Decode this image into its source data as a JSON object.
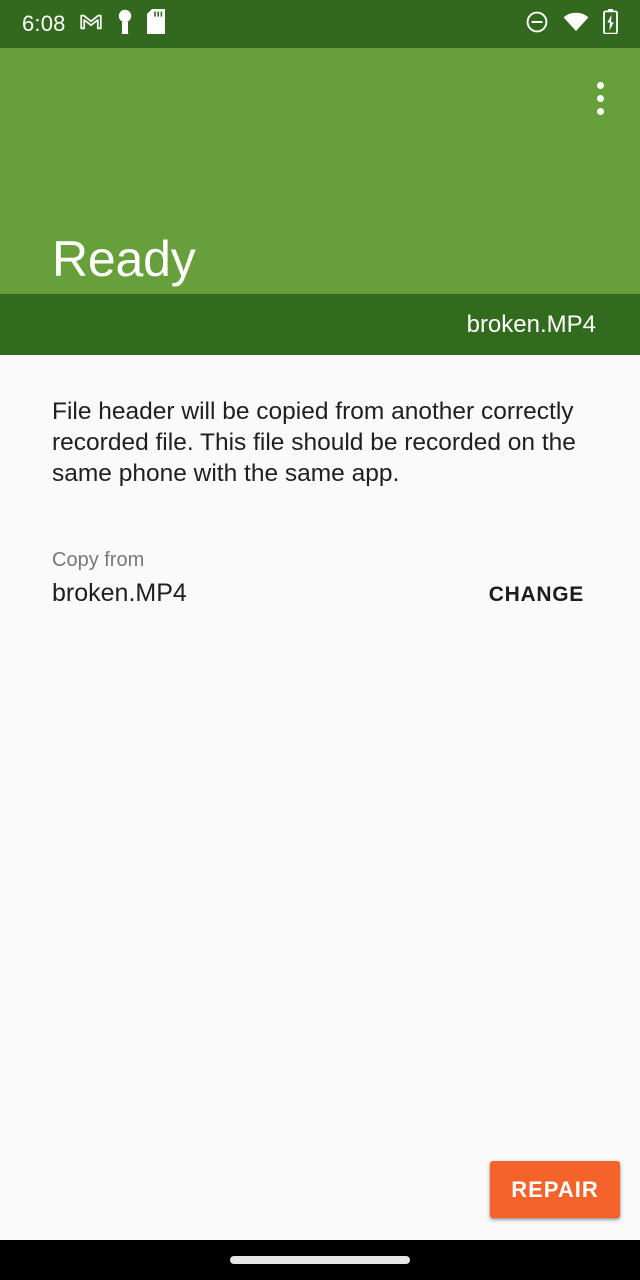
{
  "statusbar": {
    "time": "6:08",
    "left_icons": [
      "gmail-icon",
      "keyhole-icon",
      "sd-card-icon"
    ],
    "right_icons": [
      "do-not-disturb-icon",
      "wifi-icon",
      "battery-charging-icon"
    ],
    "background_color": "#33691E"
  },
  "appbar": {
    "title": "Ready",
    "overflow_label": "More options",
    "background_color": "#67A03A"
  },
  "filebar": {
    "filename": "broken.MP4",
    "background_color": "#336B1E"
  },
  "content": {
    "description": "File header will be copied from another correctly recorded file. This file should be recorded on the same phone with the same app.",
    "copy_from": {
      "label": "Copy from",
      "value": "broken.MP4",
      "change_label": "CHANGE"
    },
    "background_color": "#FAFAFA"
  },
  "actions": {
    "repair_label": "REPAIR",
    "repair_color": "#F4642A"
  },
  "navbar": {
    "gesture_pill": "home-gesture-pill",
    "background_color": "#000000"
  }
}
